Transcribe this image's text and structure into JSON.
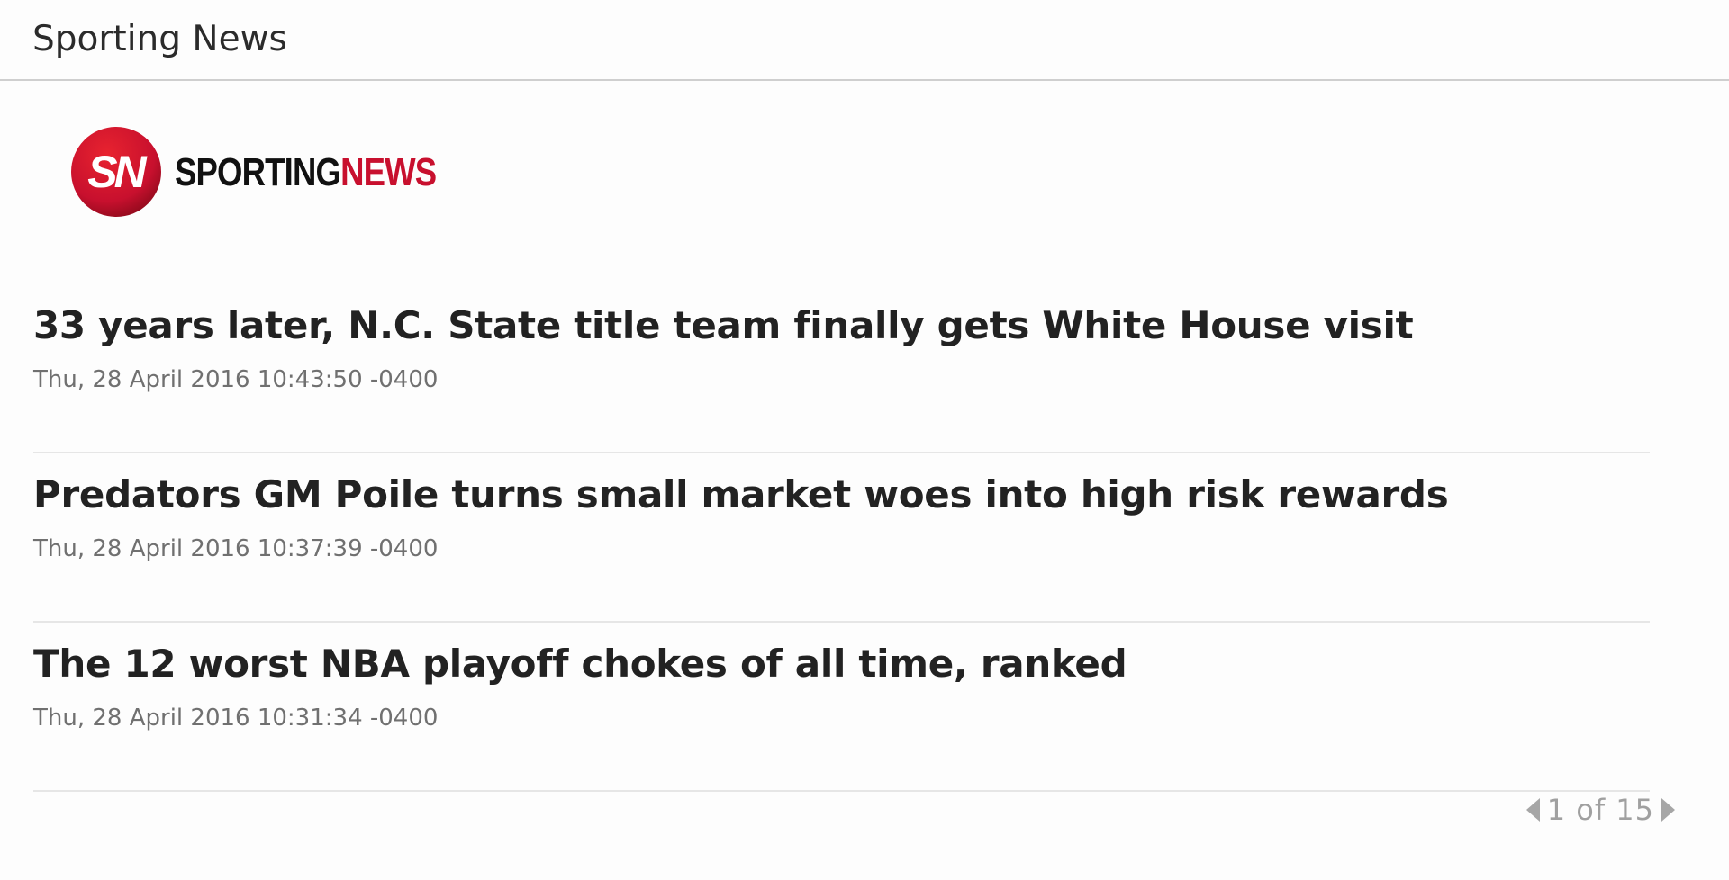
{
  "header": {
    "title": "Sporting News"
  },
  "logo": {
    "monogram": "SN",
    "word_part1": "SPORTING",
    "word_part2": "NEWS",
    "brand_color": "#c8102e"
  },
  "articles": [
    {
      "title": "33 years later, N.C. State title team finally gets White House visit",
      "date": "Thu, 28 April 2016 10:43:50 -0400"
    },
    {
      "title": "Predators GM Poile turns small market woes into high risk rewards",
      "date": "Thu, 28 April 2016 10:37:39 -0400"
    },
    {
      "title": "The 12 worst NBA playoff chokes of all time, ranked",
      "date": "Thu, 28 April 2016 10:31:34 -0400"
    }
  ],
  "pager": {
    "text": "1 of 15",
    "prev_icon": "caret-left-icon",
    "next_icon": "caret-right-icon"
  }
}
